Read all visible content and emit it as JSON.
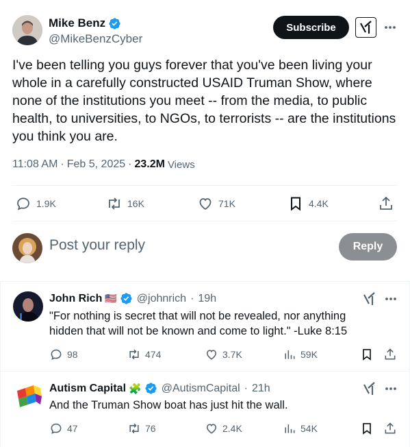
{
  "main_tweet": {
    "author_name": "Mike Benz",
    "handle": "@MikeBenzCyber",
    "subscribe_label": "Subscribe",
    "text": "I've been telling you guys forever that you've been living your whole in a carefully constructed USAID Truman Show, where none of the institutions you meet -- from the media, to public health, to universities, to NGOs, to terrorists -- are the institutions you think you are.",
    "time": "11:08 AM",
    "date": "Feb 5, 2025",
    "views_count": "23.2M",
    "views_label": "Views",
    "replies": "1.9K",
    "reposts": "16K",
    "likes": "71K",
    "bookmarks": "4.4K"
  },
  "reply_composer": {
    "placeholder": "Post your reply",
    "button_label": "Reply"
  },
  "replies": [
    {
      "name": "John Rich",
      "flag": "🇺🇸",
      "handle": "@johnrich",
      "time": "19h",
      "text": "\"For nothing is secret that will not be revealed, nor anything hidden that will not be known and come to light.\" -Luke 8:15",
      "replies": "98",
      "reposts": "474",
      "likes": "3.7K",
      "views": "59K"
    },
    {
      "name": "Autism Capital",
      "flag": "🧩",
      "handle": "@AutismCapital",
      "time": "21h",
      "text": "And the Truman Show boat has just hit the wall.",
      "replies": "47",
      "reposts": "76",
      "likes": "2.4K",
      "views": "54K"
    }
  ],
  "colors": {
    "text_primary": "#0f1419",
    "text_secondary": "#536471",
    "verified_blue": "#1d9bf0",
    "divider": "#eff3f4",
    "reply_button_disabled": "#8b8f93"
  },
  "icons": [
    "verified-badge-icon",
    "grok-icon",
    "more-icon",
    "reply-icon",
    "repost-icon",
    "like-icon",
    "bookmark-icon",
    "share-icon",
    "views-icon"
  ]
}
